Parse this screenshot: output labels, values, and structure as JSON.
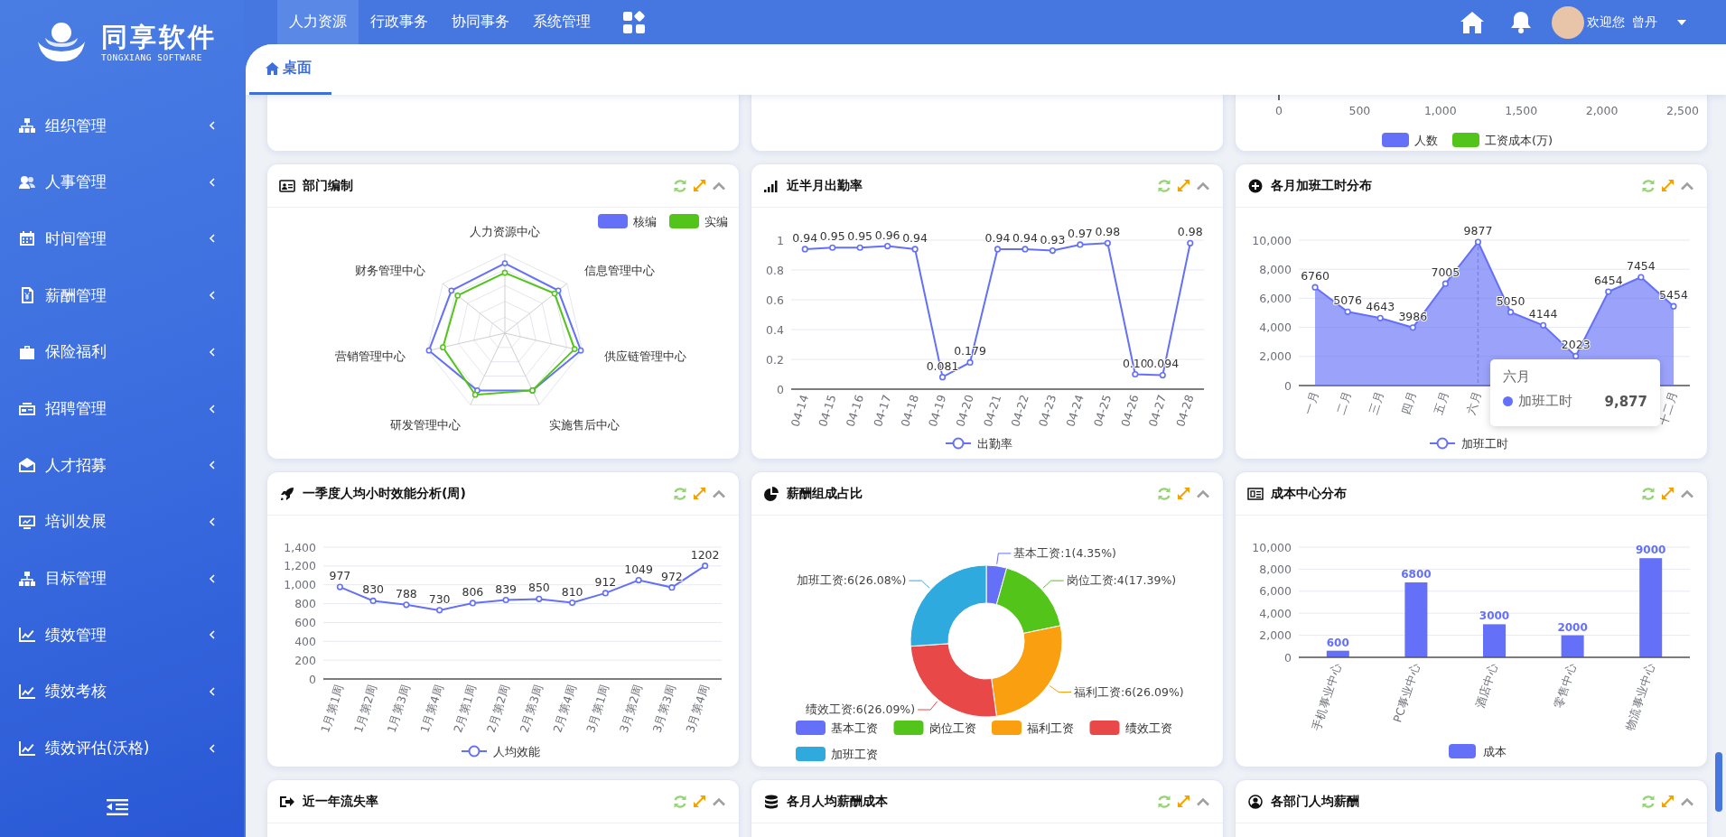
{
  "sidebar": {
    "brand": "同享软件",
    "brand_subtitle": "TONGXIANG SOFTWARE",
    "items": [
      {
        "label": "组织管理",
        "expanded": false
      },
      {
        "label": "人事管理",
        "expanded": false
      },
      {
        "label": "时间管理",
        "expanded": false
      },
      {
        "label": "薪酬管理",
        "expanded": false
      },
      {
        "label": "保险福利",
        "expanded": false
      },
      {
        "label": "招聘管理",
        "expanded": false
      },
      {
        "label": "人才招募",
        "expanded": false
      },
      {
        "label": "培训发展",
        "expanded": false
      },
      {
        "label": "目标管理",
        "expanded": false
      },
      {
        "label": "绩效管理",
        "expanded": false
      },
      {
        "label": "绩效考核",
        "expanded": false
      },
      {
        "label": "绩效评估(沃格)",
        "expanded": false
      }
    ]
  },
  "top_nav": [
    {
      "label": "人力资源",
      "selected": true
    },
    {
      "label": "行政事务",
      "selected": false
    },
    {
      "label": "协同事务",
      "selected": false
    },
    {
      "label": "系统管理",
      "selected": false
    }
  ],
  "user": {
    "greeting": "欢迎您",
    "name": "曾丹"
  },
  "tabs": [
    {
      "label": "桌面",
      "selected": true
    }
  ],
  "top_row": {
    "axis_labels": [
      "0",
      "500",
      "1,000",
      "1,500",
      "2,000",
      "2,500"
    ],
    "legend": [
      {
        "label": "人数",
        "color": "#6470f8"
      },
      {
        "label": "工资成本(万)",
        "color": "#52c41a"
      }
    ]
  },
  "cards": [
    {
      "kind": "radar",
      "title": "部门编制",
      "radar": {
        "indicators": [
          "人力资源中心",
          "财务管理中心",
          "信息管理中心",
          "营销管理中心",
          "供应链管理中心",
          "研发管理中心",
          "实施售后中心"
        ],
        "legend": [
          {
            "label": "核编",
            "color": "#6470f8"
          },
          {
            "label": "实编",
            "color": "#52c41a"
          }
        ]
      }
    },
    {
      "kind": "chart",
      "title": "近半月出勤率",
      "chart_data": {
        "type": "line",
        "categories": [
          "04-14",
          "04-15",
          "04-16",
          "04-17",
          "04-18",
          "04-19",
          "04-20",
          "04-21",
          "04-22",
          "04-23",
          "04-24",
          "04-25",
          "04-26",
          "04-27",
          "04-28"
        ],
        "series": [
          {
            "name": "出勤率",
            "color": "#6470f8",
            "marker": true,
            "values": [
              0.94,
              0.95,
              0.95,
              0.96,
              0.94,
              0.081,
              0.179,
              0.94,
              0.94,
              0.93,
              0.97,
              0.98,
              0.1,
              0.094,
              0.98
            ]
          }
        ],
        "grid": true,
        "legend": "bottom",
        "ylim": [
          0,
          1
        ],
        "yticks": [
          0,
          0.2,
          0.4,
          0.6,
          0.8,
          1
        ],
        "value_labels": [
          "0.94",
          "0.95",
          "0.95",
          "0.96",
          "0.94",
          "0.081",
          "0.179",
          "0.94",
          "0.94",
          "0.93",
          "0.97",
          "0.98",
          "0.10",
          "0.094",
          "0.98"
        ]
      }
    },
    {
      "kind": "chart",
      "title": "各月加班工时分布",
      "tooltip": {
        "title": "六月",
        "series": "加班工时",
        "value": "9,877"
      },
      "chart_data": {
        "type": "area",
        "categories": [
          "一月",
          "二月",
          "三月",
          "四月",
          "五月",
          "六月",
          null,
          null,
          null,
          null,
          null,
          "十二月"
        ],
        "ref_lines": [
          {
            "axis": "x",
            "value": "六月"
          }
        ],
        "grid": true,
        "legend": "bottom",
        "series": [
          {
            "name": "加班工时",
            "color": "#6470f8",
            "marker": true,
            "values": [
              6760,
              5076,
              4643,
              3986,
              7005,
              9877,
              5050,
              4144,
              2023,
              6454,
              7454,
              5454
            ]
          }
        ],
        "ylim": [
          0,
          10000
        ],
        "yticks": [
          {
            "value": 0,
            "label": "0"
          },
          {
            "value": 2000,
            "label": "2,000"
          },
          {
            "value": 4000,
            "label": "4,000"
          },
          {
            "value": 6000,
            "label": "6,000"
          },
          {
            "value": 8000,
            "label": "8,000"
          },
          {
            "value": 10000,
            "label": "10,000"
          }
        ],
        "data_labels": true
      }
    },
    {
      "kind": "chart",
      "title": "一季度人均小时效能分析(周)",
      "chart_data": {
        "type": "line",
        "categories": [
          "1月第1周",
          "1月第2周",
          "1月第3周",
          "1月第4周",
          "2月第1周",
          "2月第2周",
          "2月第3周",
          "2月第4周",
          "3月第1周",
          "3月第2周",
          "3月第3周",
          "3月第4周"
        ],
        "series": [
          {
            "name": "人均效能",
            "color": "#6470f8",
            "marker": true,
            "values": [
              977,
              830,
              788,
              730,
              806,
              839,
              850,
              810,
              912,
              1049,
              972,
              1202
            ]
          }
        ],
        "grid": true,
        "legend": "bottom",
        "ylim": [
          0,
          1400
        ],
        "yticks": [
          {
            "value": 0,
            "label": "0"
          },
          {
            "value": 200,
            "label": "200"
          },
          {
            "value": 400,
            "label": "400"
          },
          {
            "value": 600,
            "label": "600"
          },
          {
            "value": 800,
            "label": "800"
          },
          {
            "value": 1000,
            "label": "1,000"
          },
          {
            "value": 1200,
            "label": "1,200"
          },
          {
            "value": 1400,
            "label": "1,400"
          }
        ],
        "data_labels": true
      }
    },
    {
      "kind": "chart",
      "title": "薪酬组成占比",
      "chart_data": {
        "type": "donut",
        "categories": [
          "基本工资",
          "岗位工资",
          "福利工资",
          "绩效工资",
          "加班工资"
        ],
        "values": [
          1,
          4,
          6,
          6,
          6
        ],
        "legend": "bottom",
        "colors": [
          "#6470f8",
          "#52c41a",
          "#fa9f0f",
          "#e84848",
          "#2faadf"
        ],
        "value_labels": [
          "基本工资:1(4.35%)",
          "岗位工资:4(17.39%)",
          "福利工资:6(26.09%)",
          "绩效工资:6(26.09%)",
          "加班工资:6(26.08%)"
        ]
      }
    },
    {
      "kind": "chart",
      "title": "成本中心分布",
      "chart_data": {
        "type": "bar",
        "categories": [
          "手机事业中心",
          "PC事业中心",
          "酒店中心",
          "零售中心",
          "物流事业中心"
        ],
        "series": [
          {
            "name": "成本",
            "color": "#6470f8",
            "values": [
              600,
              6800,
              3000,
              2000,
              9000
            ]
          }
        ],
        "grid": true,
        "legend": "bottom",
        "ylim": [
          0,
          10000
        ],
        "yticks": [
          {
            "value": 0,
            "label": "0"
          },
          {
            "value": 2000,
            "label": "2,000"
          },
          {
            "value": 4000,
            "label": "4,000"
          },
          {
            "value": 6000,
            "label": "6,000"
          },
          {
            "value": 8000,
            "label": "8,000"
          },
          {
            "value": 10000,
            "label": "10,000"
          }
        ],
        "data_labels": true
      }
    },
    {
      "kind": "header",
      "title": "近一年流失率"
    },
    {
      "kind": "header",
      "title": "各月人均薪酬成本"
    },
    {
      "kind": "header",
      "title": "各部门人均薪酬"
    }
  ]
}
